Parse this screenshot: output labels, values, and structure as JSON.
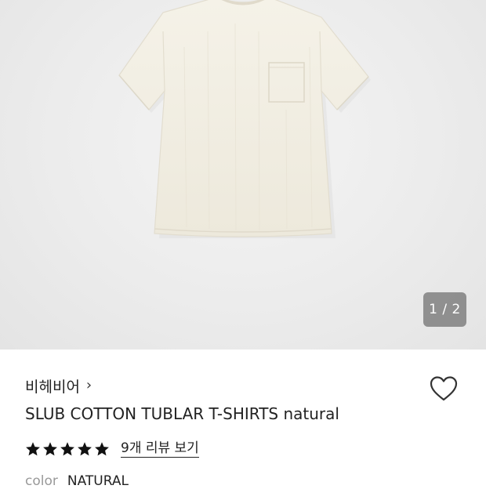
{
  "gallery": {
    "image_alt_icon": "tshirt-product-photo",
    "counter": "1 / 2"
  },
  "product": {
    "brand": "비헤비어",
    "brand_chevron": "›",
    "title": "SLUB COTTON TUBLAR T-SHIRTS natural",
    "rating_stars": 5,
    "review_link": "9개 리뷰 보기",
    "option_label": "color",
    "option_value": "NATURAL"
  },
  "icons": {
    "wishlist": "heart-outline-icon",
    "star": "star-icon",
    "brand_link": "chevron-right-icon"
  },
  "colors": {
    "star": "#111111",
    "text": "#222222",
    "muted": "#999999"
  }
}
